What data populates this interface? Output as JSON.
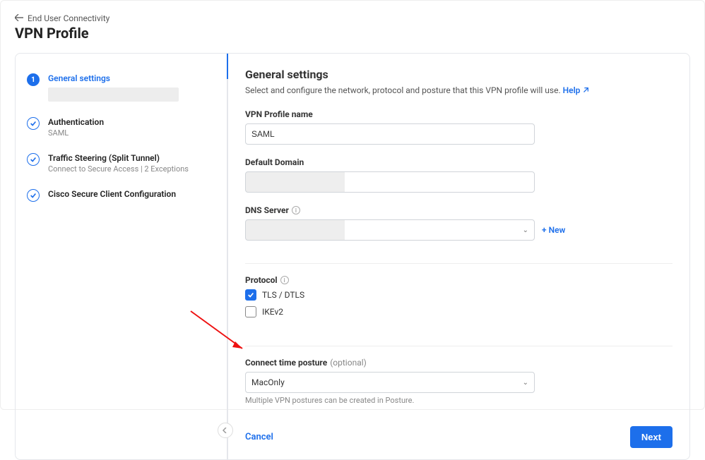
{
  "breadcrumb": {
    "parent": "End User Connectivity"
  },
  "page": {
    "title": "VPN Profile"
  },
  "steps": [
    {
      "label": "General settings",
      "active": true,
      "num": "1"
    },
    {
      "label": "Authentication",
      "sub": "SAML"
    },
    {
      "label": "Traffic Steering (Split Tunnel)",
      "sub": "Connect to Secure Access | 2 Exceptions"
    },
    {
      "label": "Cisco Secure Client Configuration"
    }
  ],
  "main": {
    "heading": "General settings",
    "description": "Select and configure the network, protocol and posture that this VPN profile will use.",
    "help_label": "Help"
  },
  "fields": {
    "profile_name": {
      "label": "VPN Profile name",
      "value": "SAML"
    },
    "default_domain": {
      "label": "Default Domain",
      "value": ""
    },
    "dns_server": {
      "label": "DNS Server",
      "value": "",
      "new_label": "+ New"
    },
    "protocol": {
      "label": "Protocol",
      "options": [
        {
          "label": "TLS / DTLS",
          "checked": true
        },
        {
          "label": "IKEv2",
          "checked": false
        }
      ]
    },
    "posture": {
      "label": "Connect time posture",
      "optional": "(optional)",
      "value": "MacOnly",
      "hint": "Multiple VPN postures can be created in Posture."
    }
  },
  "actions": {
    "cancel": "Cancel",
    "next": "Next"
  }
}
